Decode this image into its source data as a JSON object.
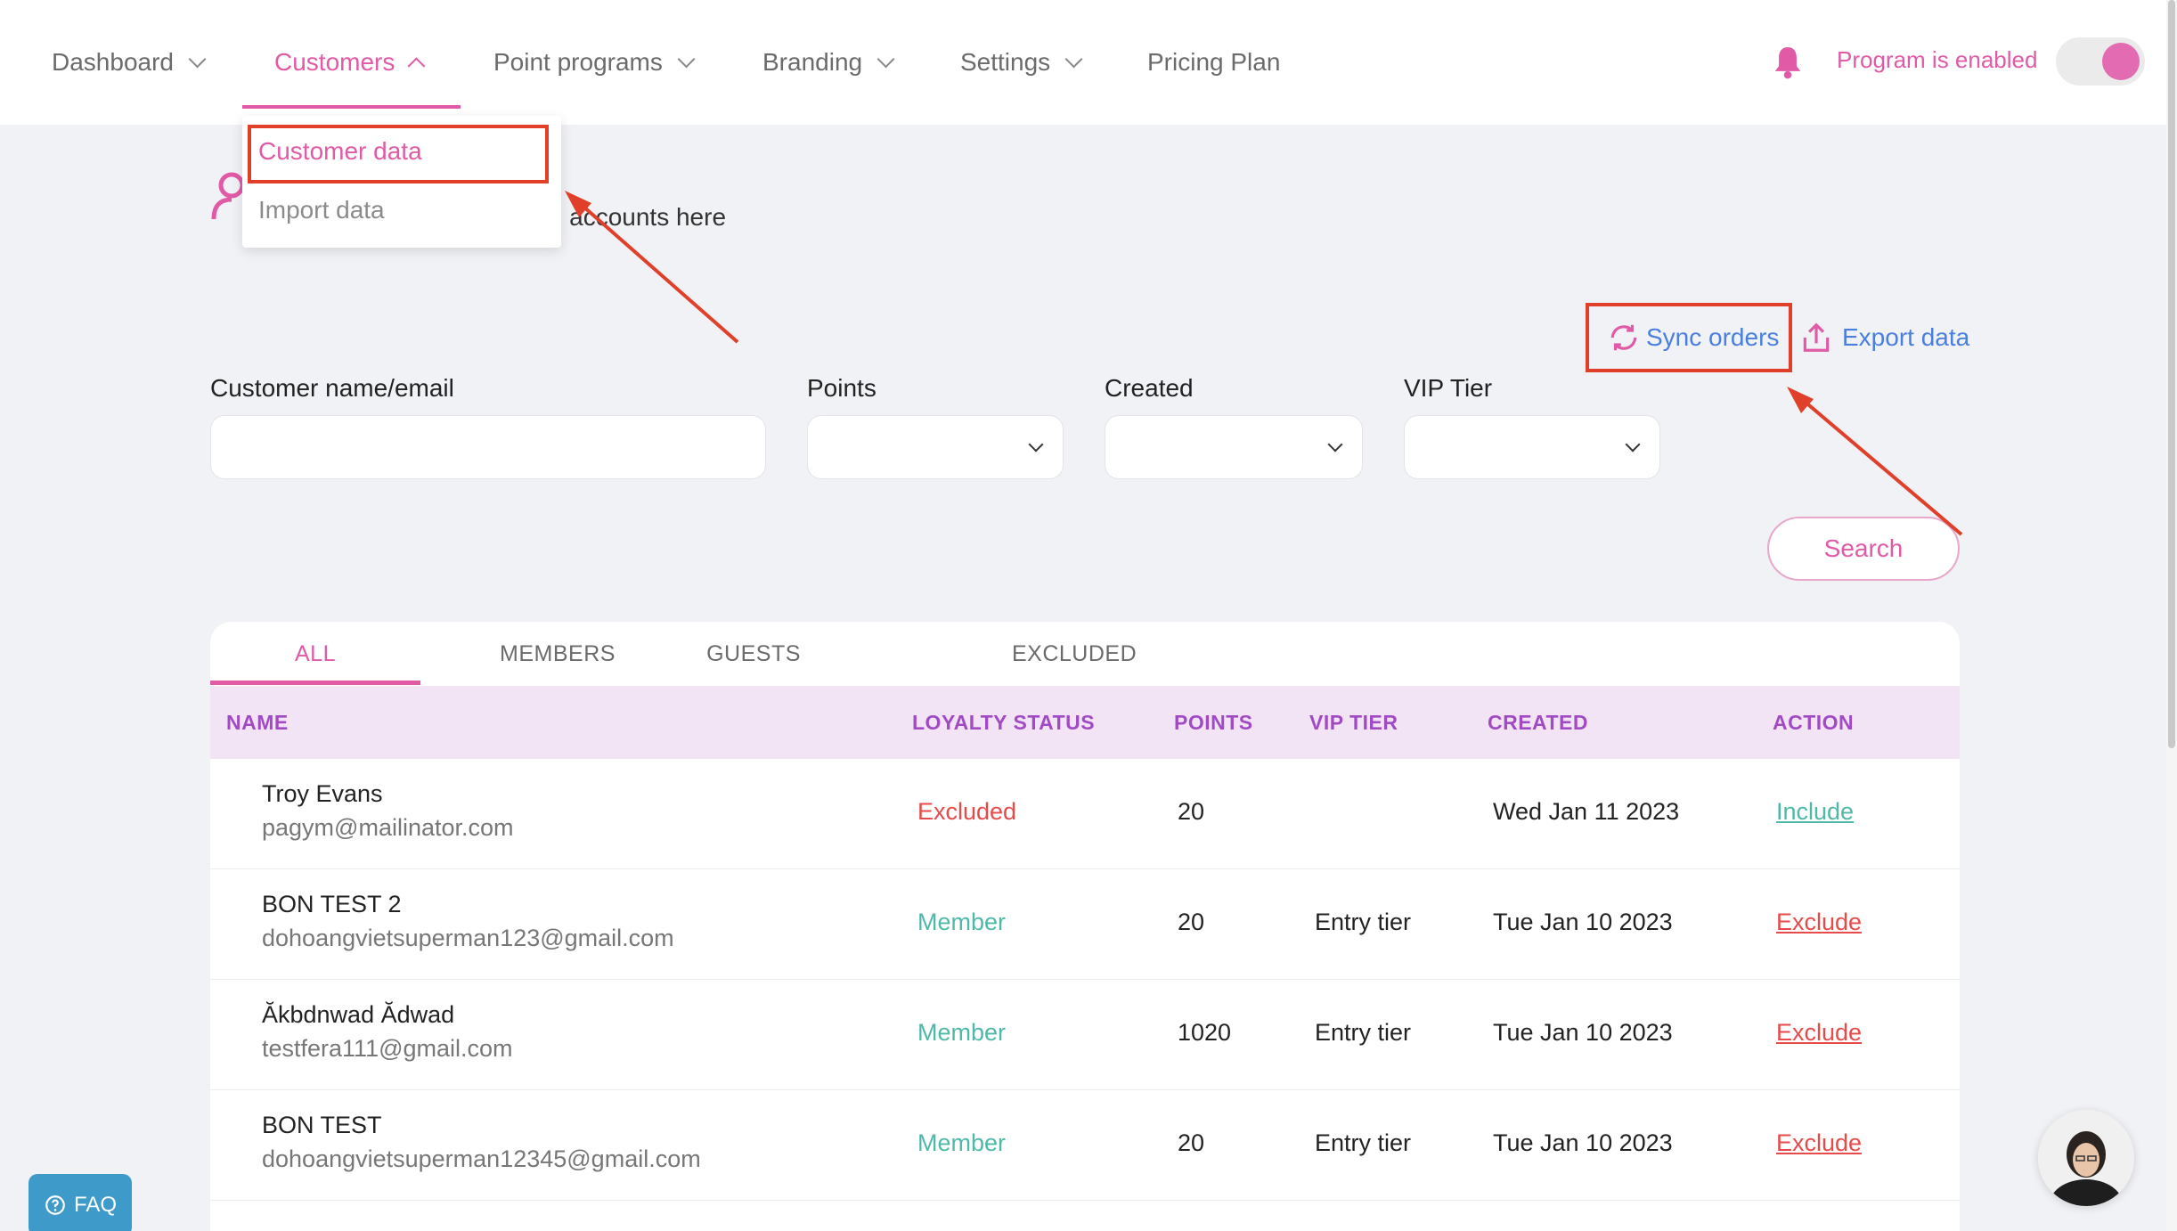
{
  "nav": {
    "items": [
      {
        "label": "Dashboard"
      },
      {
        "label": "Customers"
      },
      {
        "label": "Point programs"
      },
      {
        "label": "Branding"
      },
      {
        "label": "Settings"
      },
      {
        "label": "Pricing Plan"
      }
    ],
    "program_status": "Program is enabled"
  },
  "dropdown": {
    "items": [
      "Customer data",
      "Import data"
    ]
  },
  "page": {
    "description_visible": "s' accounts here"
  },
  "actions": {
    "sync": "Sync orders",
    "export": "Export data"
  },
  "filters": {
    "name_label": "Customer name/email",
    "points_label": "Points",
    "created_label": "Created",
    "vip_label": "VIP Tier",
    "search_button": "Search"
  },
  "tabs": [
    "ALL",
    "MEMBERS",
    "GUESTS",
    "EXCLUDED"
  ],
  "table": {
    "headers": [
      "NAME",
      "LOYALTY STATUS",
      "POINTS",
      "VIP TIER",
      "CREATED",
      "ACTION"
    ],
    "rows": [
      {
        "name": "Troy Evans",
        "email": "pagym@mailinator.com",
        "status": "Excluded",
        "points": "20",
        "tier": "",
        "created": "Wed Jan 11 2023",
        "action": "Include"
      },
      {
        "name": "BON TEST 2",
        "email": "dohoangvietsuperman123@gmail.com",
        "status": "Member",
        "points": "20",
        "tier": "Entry tier",
        "created": "Tue Jan 10 2023",
        "action": "Exclude"
      },
      {
        "name": "Ăkbdnwad Ădwad",
        "email": "testfera111@gmail.com",
        "status": "Member",
        "points": "1020",
        "tier": "Entry tier",
        "created": "Tue Jan 10 2023",
        "action": "Exclude"
      },
      {
        "name": "BON TEST",
        "email": "dohoangvietsuperman12345@gmail.com",
        "status": "Member",
        "points": "20",
        "tier": "Entry tier",
        "created": "Tue Jan 10 2023",
        "action": "Exclude"
      }
    ]
  },
  "faq": "FAQ",
  "colors": {
    "accent": "#e05aa6",
    "member": "#4fb8a8",
    "excluded": "#e84a4a",
    "link": "#4a7fe0",
    "annotation": "#e0402a"
  }
}
